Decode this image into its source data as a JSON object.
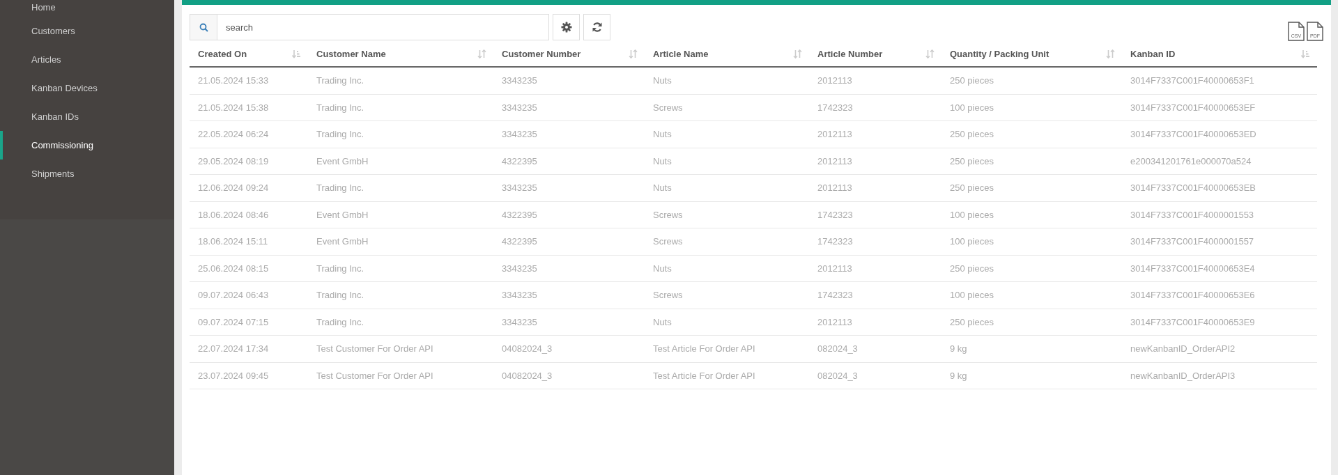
{
  "sidebar": {
    "items": [
      {
        "label": "Home",
        "selected": false
      },
      {
        "label": "Customers",
        "selected": false
      },
      {
        "label": "Articles",
        "selected": false
      },
      {
        "label": "Kanban Devices",
        "selected": false
      },
      {
        "label": "Kanban IDs",
        "selected": false
      },
      {
        "label": "Commissioning",
        "selected": true
      },
      {
        "label": "Shipments",
        "selected": false
      }
    ]
  },
  "toolbar": {
    "search": {
      "placeholder": "search"
    },
    "exports": [
      "CSV",
      "PDF"
    ]
  },
  "table": {
    "columns": [
      {
        "label": "Created On",
        "sorted": true
      },
      {
        "label": "Customer Name",
        "sorted": false
      },
      {
        "label": "Customer Number",
        "sorted": false
      },
      {
        "label": "Article Name",
        "sorted": false
      },
      {
        "label": "Article Number",
        "sorted": false
      },
      {
        "label": "Quantity / Packing Unit",
        "sorted": false
      },
      {
        "label": "Kanban ID",
        "sorted": true
      }
    ],
    "rows": [
      [
        "21.05.2024 15:33",
        "Trading Inc.",
        "3343235",
        "Nuts",
        "2012113",
        "250 pieces",
        "3014F7337C001F40000653F1"
      ],
      [
        "21.05.2024 15:38",
        "Trading Inc.",
        "3343235",
        "Screws",
        "1742323",
        "100 pieces",
        "3014F7337C001F40000653EF"
      ],
      [
        "22.05.2024 06:24",
        "Trading Inc.",
        "3343235",
        "Nuts",
        "2012113",
        "250 pieces",
        "3014F7337C001F40000653ED"
      ],
      [
        "29.05.2024 08:19",
        "Event GmbH",
        "4322395",
        "Nuts",
        "2012113",
        "250 pieces",
        "e200341201761e000070a524"
      ],
      [
        "12.06.2024 09:24",
        "Trading Inc.",
        "3343235",
        "Nuts",
        "2012113",
        "250 pieces",
        "3014F7337C001F40000653EB"
      ],
      [
        "18.06.2024 08:46",
        "Event GmbH",
        "4322395",
        "Screws",
        "1742323",
        "100 pieces",
        "3014F7337C001F4000001553"
      ],
      [
        "18.06.2024 15:11",
        "Event GmbH",
        "4322395",
        "Screws",
        "1742323",
        "100 pieces",
        "3014F7337C001F4000001557"
      ],
      [
        "25.06.2024 08:15",
        "Trading Inc.",
        "3343235",
        "Nuts",
        "2012113",
        "250 pieces",
        "3014F7337C001F40000653E4"
      ],
      [
        "09.07.2024 06:43",
        "Trading Inc.",
        "3343235",
        "Screws",
        "1742323",
        "100 pieces",
        "3014F7337C001F40000653E6"
      ],
      [
        "09.07.2024 07:15",
        "Trading Inc.",
        "3343235",
        "Nuts",
        "2012113",
        "250 pieces",
        "3014F7337C001F40000653E9"
      ],
      [
        "22.07.2024 17:34",
        "Test Customer For Order API",
        "04082024_3",
        "Test Article For Order API",
        "082024_3",
        "9 kg",
        "newKanbanID_OrderAPI2"
      ],
      [
        "23.07.2024 09:45",
        "Test Customer For Order API",
        "04082024_3",
        "Test Article For Order API",
        "082024_3",
        "9 kg",
        "newKanbanID_OrderAPI3"
      ]
    ]
  }
}
